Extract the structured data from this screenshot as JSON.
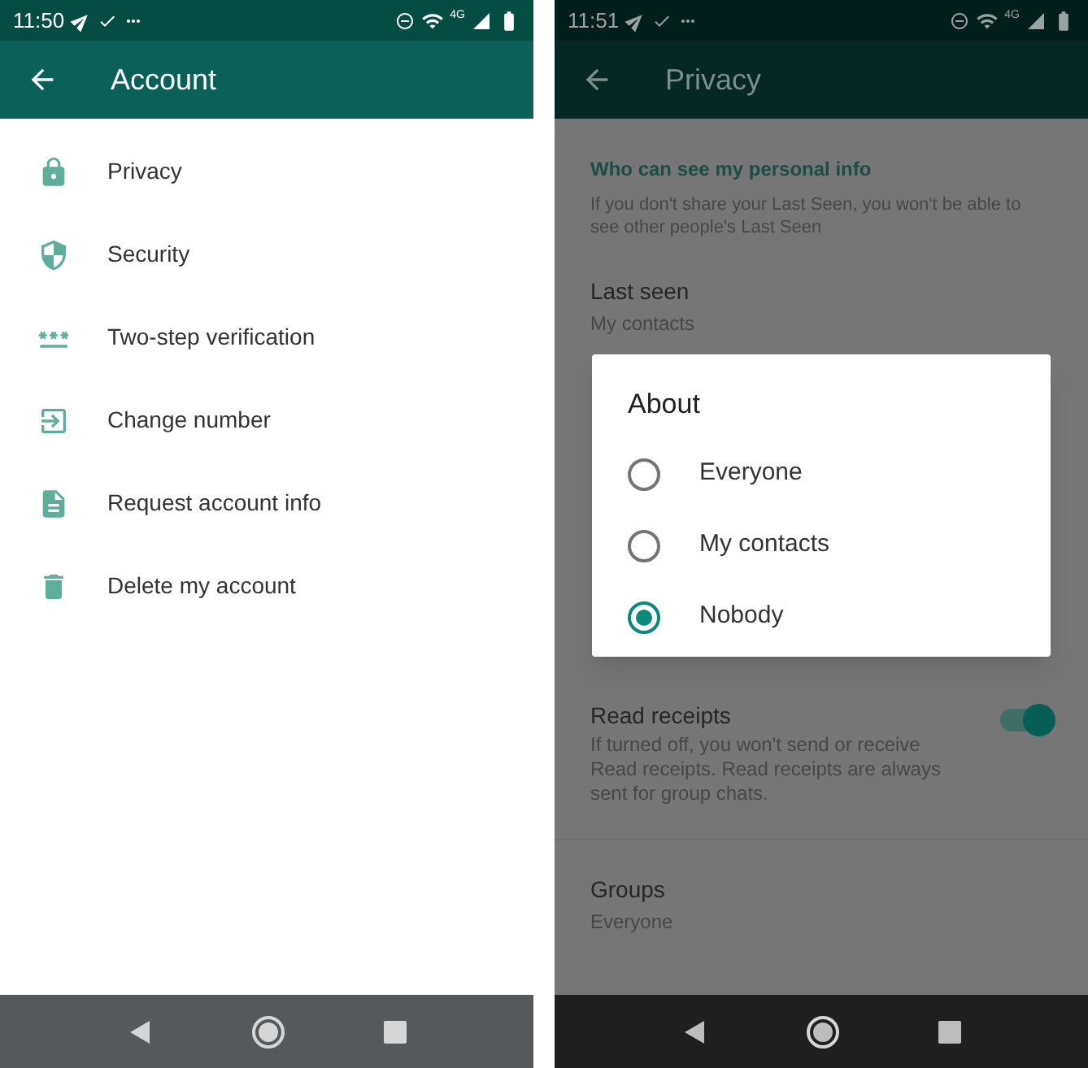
{
  "screens": [
    {
      "kind": "account",
      "status_bar": {
        "time": "11:50",
        "network": "4G"
      },
      "app_bar": {
        "title": "Account"
      },
      "items": [
        {
          "label": "Privacy"
        },
        {
          "label": "Security"
        },
        {
          "label": "Two-step verification"
        },
        {
          "label": "Change number"
        },
        {
          "label": "Request account info"
        },
        {
          "label": "Delete my account"
        }
      ]
    },
    {
      "kind": "privacy",
      "status_bar": {
        "time": "11:51",
        "network": "4G"
      },
      "app_bar": {
        "title": "Privacy"
      },
      "section": {
        "heading": "Who can see my personal info",
        "note": "If you don't share your Last Seen, you won't be able to see other people's Last Seen"
      },
      "last_seen": {
        "title": "Last seen",
        "value": "My contacts"
      },
      "dialog": {
        "title": "About",
        "options": [
          {
            "label": "Everyone",
            "selected": false
          },
          {
            "label": "My contacts",
            "selected": false
          },
          {
            "label": "Nobody",
            "selected": true
          }
        ]
      },
      "read_receipts": {
        "title": "Read receipts",
        "description": "If turned off, you won't send or receive Read receipts. Read receipts are always sent for group chats.",
        "on": true
      },
      "groups": {
        "title": "Groups",
        "value": "Everyone"
      }
    }
  ]
}
